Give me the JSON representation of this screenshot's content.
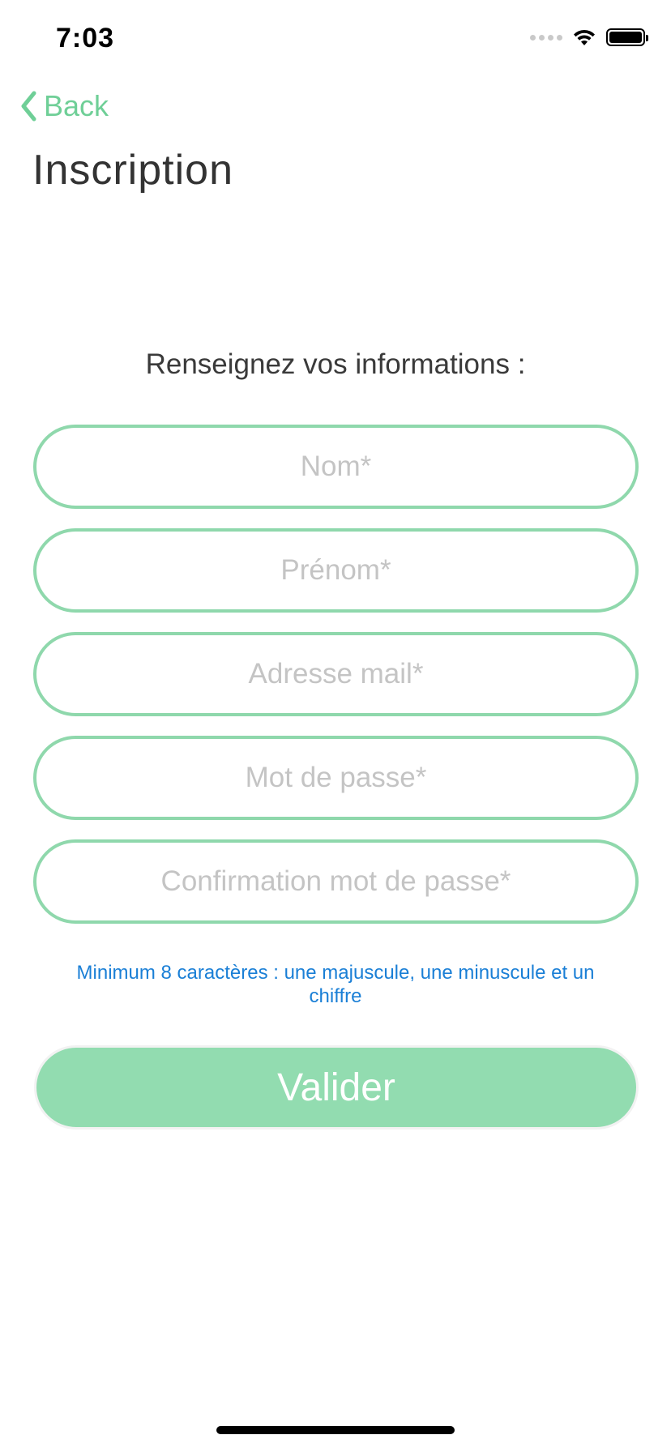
{
  "status_bar": {
    "time": "7:03"
  },
  "nav": {
    "back_label": "Back",
    "title": "Inscription"
  },
  "form": {
    "prompt": "Renseignez vos informations :",
    "fields": [
      {
        "placeholder": "Nom*",
        "value": ""
      },
      {
        "placeholder": "Prénom*",
        "value": ""
      },
      {
        "placeholder": "Adresse mail*",
        "value": ""
      },
      {
        "placeholder": "Mot de passe*",
        "value": ""
      },
      {
        "placeholder": "Confirmation mot de passe*",
        "value": ""
      }
    ],
    "password_hint": "Minimum 8 caractères : une majuscule, une minuscule et un chiffre",
    "submit_label": "Valider"
  },
  "colors": {
    "accent": "#6fcf97",
    "field_border": "#8fd8ac",
    "button_fill": "#92dcb0",
    "hint_text": "#1a7fd6"
  },
  "icons": {
    "back": "chevron-left-icon",
    "signal": "cellular-signal-icon",
    "wifi": "wifi-icon",
    "battery": "battery-icon"
  }
}
